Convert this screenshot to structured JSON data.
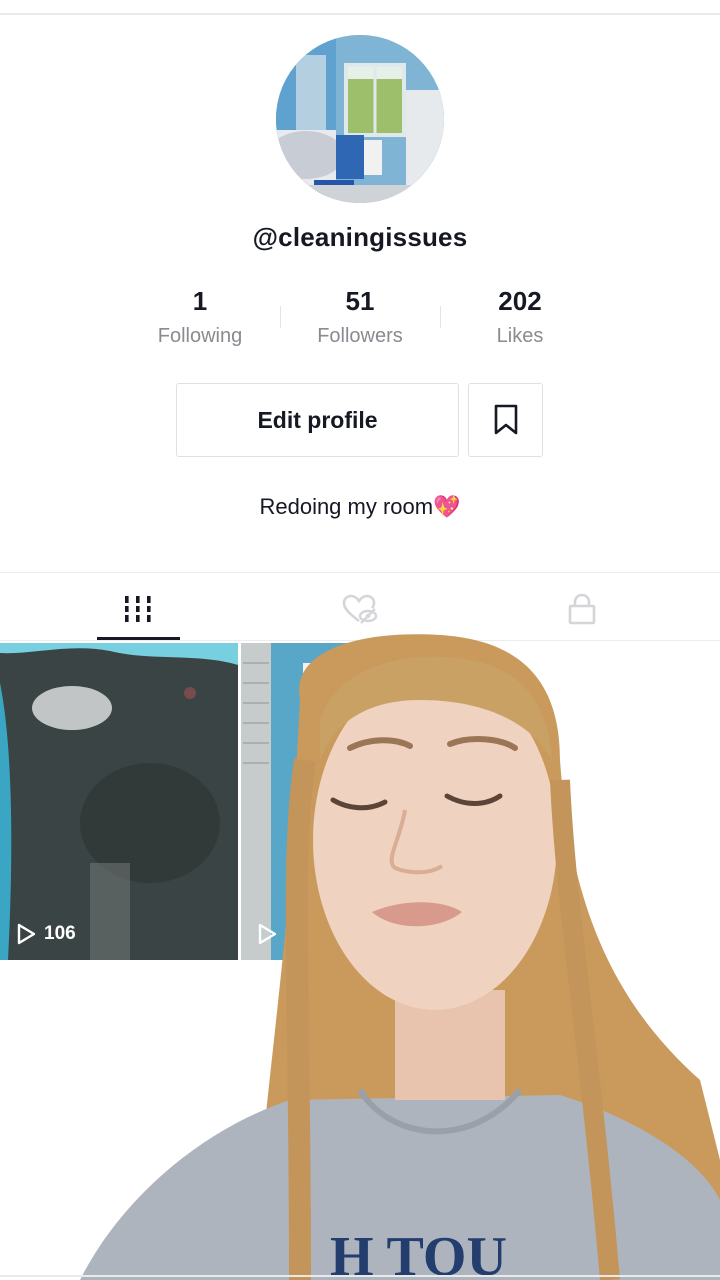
{
  "profile": {
    "username": "@cleaningissues",
    "bio_text": "Redoing my room",
    "bio_emoji": "💖",
    "avatar_icon": "room-photo"
  },
  "stats": [
    {
      "value": "1",
      "label": "Following"
    },
    {
      "value": "51",
      "label": "Followers"
    },
    {
      "value": "202",
      "label": "Likes"
    }
  ],
  "actions": {
    "edit_profile_label": "Edit profile",
    "bookmark_icon": "bookmark-icon"
  },
  "tabs": [
    {
      "icon": "grid-videos-icon",
      "active": true
    },
    {
      "icon": "liked-hidden-icon",
      "active": false
    },
    {
      "icon": "lock-icon",
      "active": false
    }
  ],
  "videos": [
    {
      "views": "106"
    },
    {
      "views": ""
    }
  ],
  "colors": {
    "text_primary": "#161823",
    "text_secondary": "#8a8b91",
    "border": "#e1e1e3"
  }
}
